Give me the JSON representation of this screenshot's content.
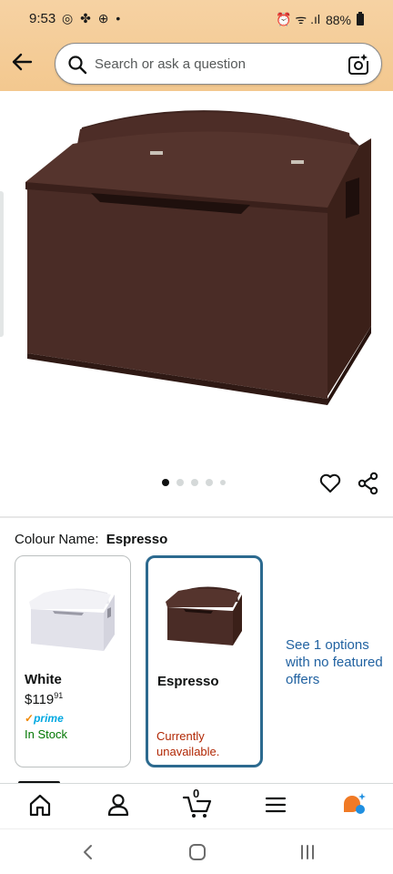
{
  "status_bar": {
    "time": "9:53",
    "left_icons": "◎ ✤ ⊕ •",
    "right_icons": "⏰ ᯤ .ıl",
    "battery": "88%"
  },
  "header": {
    "search_placeholder": "Search or ask a question",
    "accent_color": "#f3c88f"
  },
  "gallery": {
    "image_count": 5,
    "active_index": 0
  },
  "variation": {
    "label": "Colour Name:",
    "selected": "Espresso"
  },
  "options": [
    {
      "name": "White",
      "price_whole": "$119",
      "price_fraction": "91",
      "prime": "prime",
      "availability": "In Stock"
    },
    {
      "name": "Espresso",
      "availability": "Currently unavailable."
    }
  ],
  "more_options": "See 1 options with no featured offers",
  "bottom_nav": {
    "cart_count": "0",
    "items": [
      "home-icon",
      "account-icon",
      "cart-icon",
      "menu-icon",
      "rufus-icon"
    ]
  },
  "colors": {
    "link": "#2162a1",
    "selected_border": "#2c6a8f",
    "in_stock": "#007600",
    "unavailable": "#b12704",
    "espresso_wood": "#4a2c26"
  }
}
